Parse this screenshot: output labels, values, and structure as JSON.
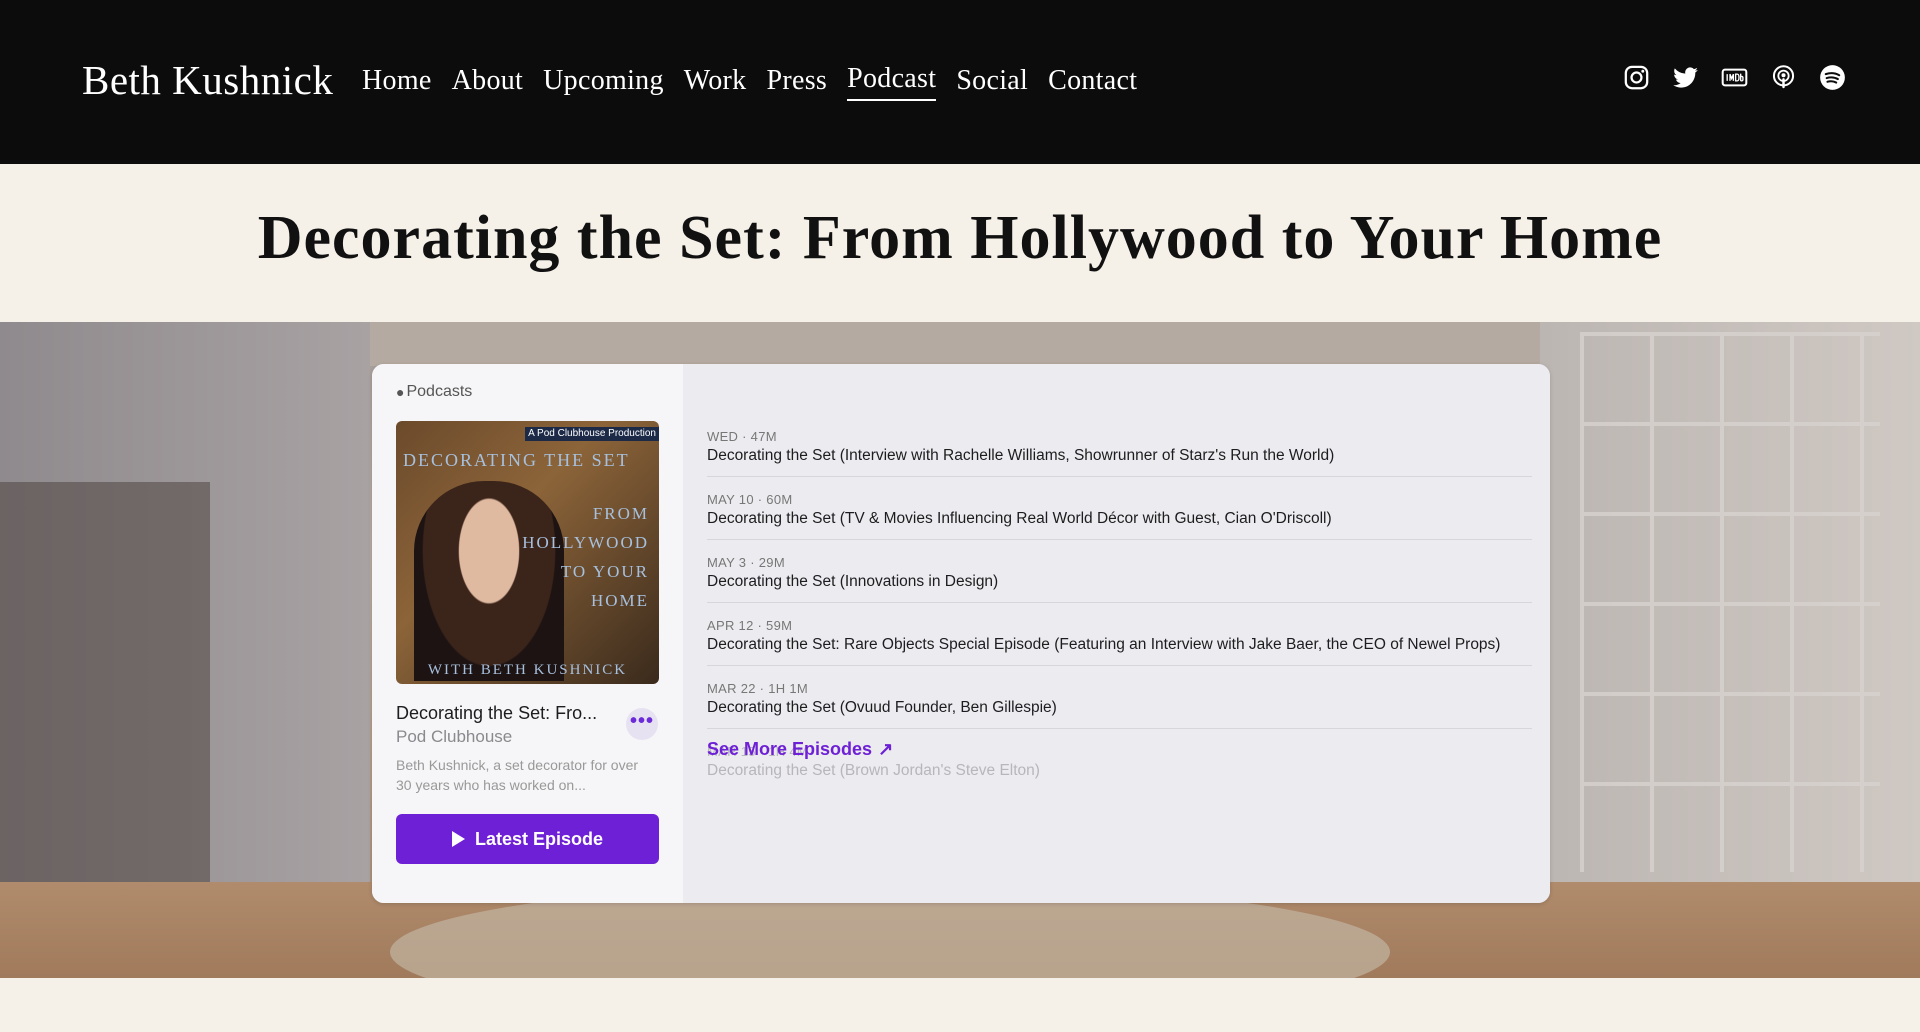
{
  "header": {
    "site_title": "Beth Kushnick",
    "nav": [
      {
        "label": "Home"
      },
      {
        "label": "About"
      },
      {
        "label": "Upcoming"
      },
      {
        "label": "Work"
      },
      {
        "label": "Press"
      },
      {
        "label": "Podcast",
        "active": true
      },
      {
        "label": "Social"
      },
      {
        "label": "Contact"
      }
    ],
    "social_icons": [
      "instagram-icon",
      "twitter-icon",
      "imdb-icon",
      "apple-podcasts-icon",
      "spotify-icon"
    ]
  },
  "page": {
    "title": "Decorating the Set: From Hollywood to Your Home"
  },
  "player": {
    "brand": "Podcasts",
    "artwork": {
      "badge": "A Pod Clubhouse Production",
      "line1": "DECORATING THE SET",
      "line2": "FROM",
      "line3": "HOLLYWOOD",
      "line4": "TO YOUR",
      "line5": "HOME",
      "footer": "WITH BETH KUSHNICK"
    },
    "show_title": "Decorating the Set: Fro...",
    "author": "Pod Clubhouse",
    "description": "Beth Kushnick, a set decorator for over 30 years who has worked on...",
    "more_label": "•••",
    "latest_label": "Latest Episode",
    "episodes": [
      {
        "meta": "WED · 47M",
        "title": "Decorating the Set (Interview with Rachelle Williams, Showrunner of Starz's Run the World)"
      },
      {
        "meta": "MAY 10 · 60M",
        "title": "Decorating the Set (TV & Movies Influencing Real World Décor with Guest, Cian O'Driscoll)"
      },
      {
        "meta": "MAY 3 · 29M",
        "title": "Decorating the Set (Innovations in Design)"
      },
      {
        "meta": "APR 12 · 59M",
        "title": "Decorating the Set: Rare Objects Special Episode (Featuring an Interview with Jake Baer, the CEO of Newel Props)"
      },
      {
        "meta": "MAR 22 · 1H 1M",
        "title": "Decorating the Set (Ovuud Founder, Ben Gillespie)"
      },
      {
        "meta": "MAR 15 · 1H 4M",
        "title": "Decorating the Set (Brown Jordan's Steve Elton)"
      }
    ],
    "see_more_label": "See More Episodes",
    "accent_color": "#6e20d6"
  }
}
